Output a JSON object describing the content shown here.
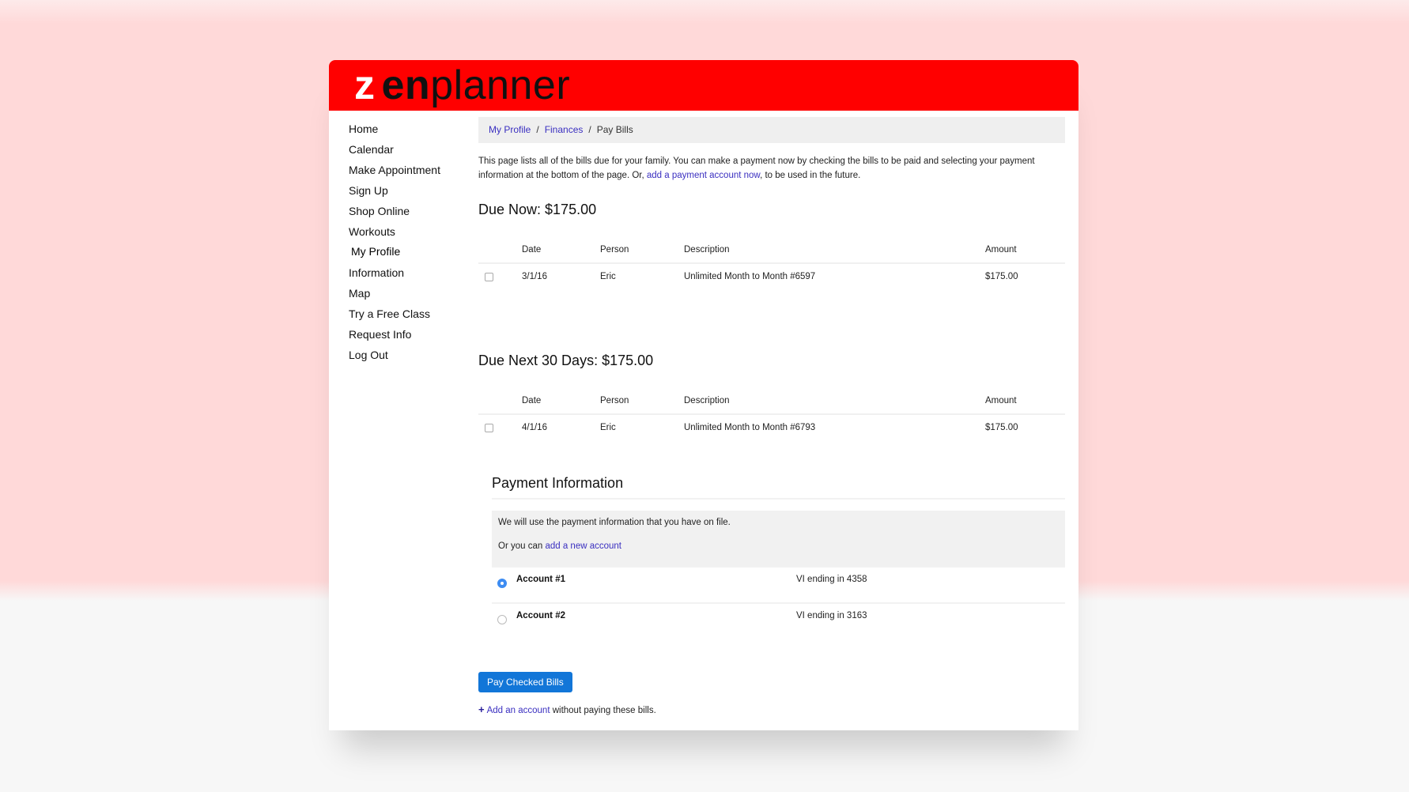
{
  "brand": {
    "z": "z",
    "en": "en",
    "planner": "planner",
    "header_color": "#ff0000"
  },
  "sidebar": {
    "items": [
      {
        "label": "Home"
      },
      {
        "label": "Calendar"
      },
      {
        "label": "Make Appointment"
      },
      {
        "label": "Sign Up"
      },
      {
        "label": "Shop Online"
      },
      {
        "label": "Workouts"
      }
    ],
    "section_label": "My Profile",
    "profile_items": [
      {
        "label": "Information"
      },
      {
        "label": "Map"
      },
      {
        "label": "Try a Free Class"
      },
      {
        "label": "Request Info"
      },
      {
        "label": "Log Out"
      }
    ]
  },
  "breadcrumb": {
    "items": [
      "My Profile",
      "Finances"
    ],
    "separator": "/",
    "current": "Pay Bills"
  },
  "intro": {
    "text_before": "This page lists all of the bills due for your family. You can make a payment now by checking the bills to be paid and selecting your payment information at the bottom of the page. Or, ",
    "link": "add a payment account now",
    "text_after": ", to be used in the future."
  },
  "due_now": {
    "title": "Due Now: $175.00",
    "columns": [
      "Date",
      "Person",
      "Description",
      "Amount"
    ],
    "rows": [
      {
        "checked": false,
        "date": "3/1/16",
        "person": "Eric",
        "description": "Unlimited Month to Month #6597",
        "amount": "$175.00"
      }
    ]
  },
  "due_next": {
    "title": "Due Next 30 Days: $175.00",
    "columns": [
      "Date",
      "Person",
      "Description",
      "Amount"
    ],
    "rows": [
      {
        "checked": false,
        "date": "4/1/16",
        "person": "Eric",
        "description": "Unlimited Month to Month #6793",
        "amount": "$175.00"
      }
    ]
  },
  "payment": {
    "title": "Payment Information",
    "on_file_text": "We will use the payment information that you have on file.",
    "or_text": "Or you can ",
    "add_new_link": "add a new account",
    "accounts": [
      {
        "name": "Account #1",
        "card": "VI ending in 4358",
        "selected": true
      },
      {
        "name": "Account #2",
        "card": "VI ending in 3163",
        "selected": false
      }
    ]
  },
  "actions": {
    "pay_button": "Pay Checked Bills",
    "add_account_link": "Add an account",
    "add_account_suffix": " without paying these bills.",
    "plus": "+",
    "button_color": "#1276d8"
  }
}
